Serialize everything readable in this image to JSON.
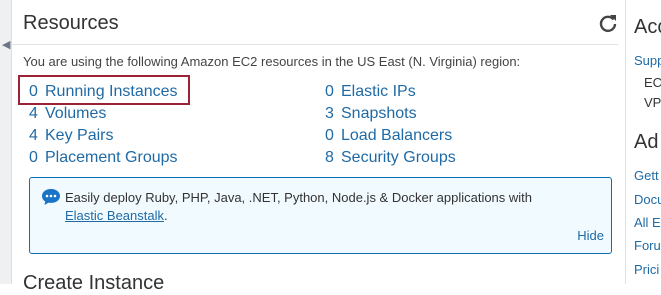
{
  "resources": {
    "title": "Resources",
    "intro": "You are using the following Amazon EC2 resources in the US East (N. Virginia) region:",
    "left_items": [
      {
        "count": "0",
        "label": "Running Instances"
      },
      {
        "count": "4",
        "label": "Volumes"
      },
      {
        "count": "4",
        "label": "Key Pairs"
      },
      {
        "count": "0",
        "label": "Placement Groups"
      }
    ],
    "right_items": [
      {
        "count": "0",
        "label": "Elastic IPs"
      },
      {
        "count": "3",
        "label": "Snapshots"
      },
      {
        "count": "0",
        "label": "Load Balancers"
      },
      {
        "count": "8",
        "label": "Security Groups"
      }
    ],
    "info": {
      "text": "Easily deploy Ruby, PHP, Java, .NET, Python, Node.js & Docker applications with",
      "link": "Elastic Beanstalk",
      "after_link": ".",
      "hide": "Hide"
    }
  },
  "create_instance": {
    "title": "Create Instance"
  },
  "right_panel": {
    "heading1": "Acc",
    "link1": "Supp",
    "text1": "EC",
    "text2": "VP",
    "heading2": "Ad",
    "links": [
      "Gett",
      "Docu",
      "All E",
      "Foru",
      "Prici"
    ]
  },
  "colors": {
    "link": "#1f6aa5",
    "highlight": "#9b2335",
    "info_border": "#0b6fb5",
    "info_bg": "#f1faff"
  }
}
